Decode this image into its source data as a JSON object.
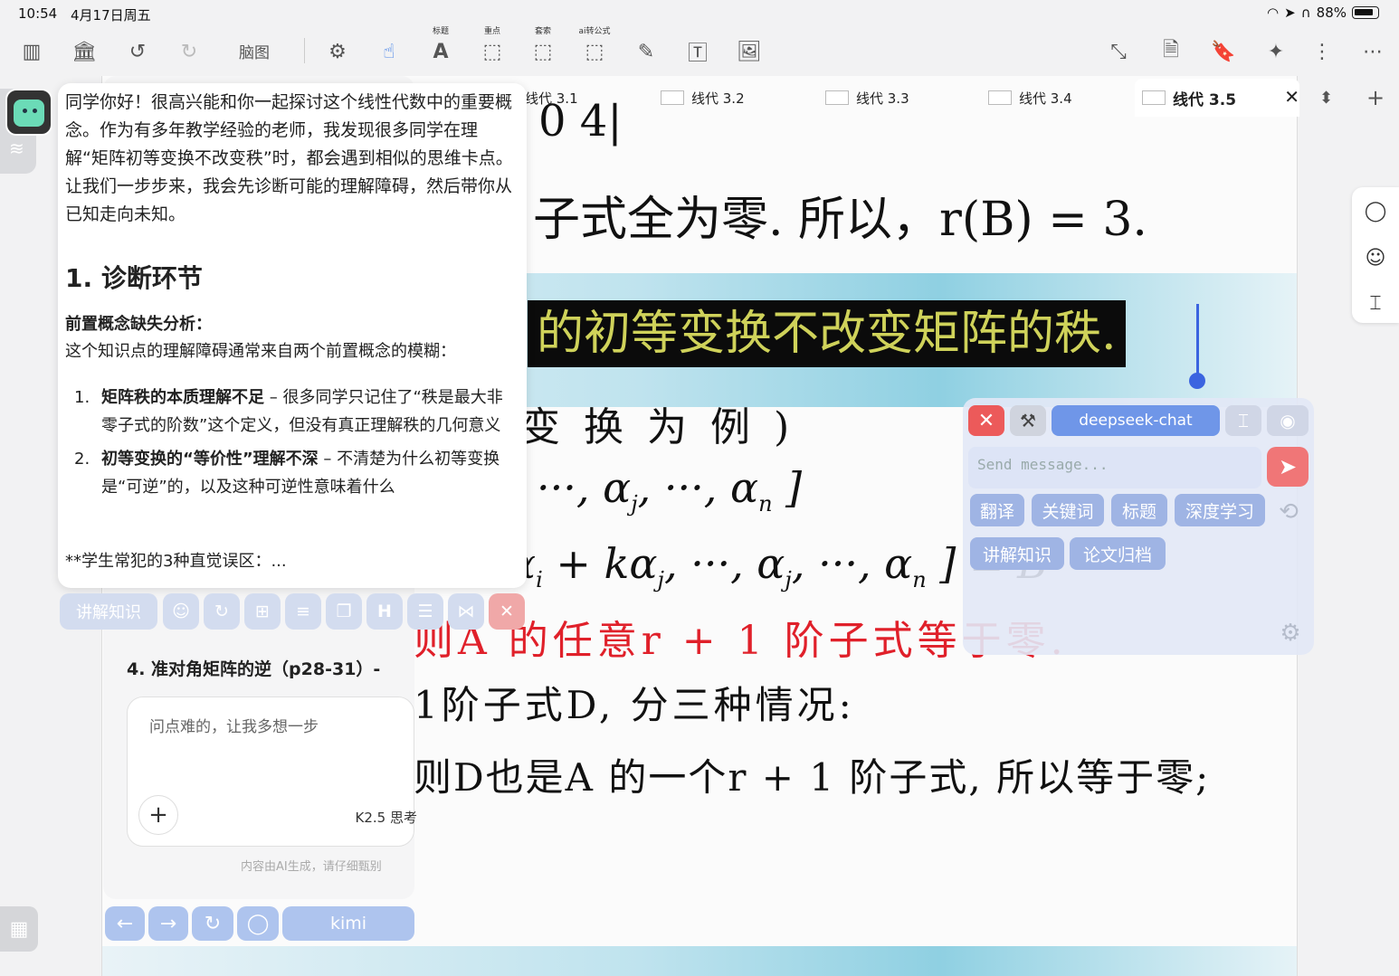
{
  "status": {
    "time": "10:54",
    "date": "4月17日周五",
    "battery": "88%"
  },
  "toolbar": {
    "mindmap_label": "脑图",
    "cap_title": "标题",
    "cap_highlight": "重点",
    "cap_lasso": "套索",
    "cap_ai_formula": "ai转公式"
  },
  "tabs": [
    {
      "label": "线代 3.1"
    },
    {
      "label": "线代 3.2"
    },
    {
      "label": "线代 3.3"
    },
    {
      "label": "线代 3.4"
    },
    {
      "label": "线代 3.5",
      "active": true
    }
  ],
  "doc": {
    "line_top": "0      4|",
    "line1": "子式全为零. 所以，r(B) = 3.",
    "headline": "的初等变换不改变矩阵的秩.",
    "line2": "变 换 为 例 )",
    "line3": "···, α",
    "line3_sub_j": "j",
    "line3_mid": ", ···, α",
    "line3_sub_n": "n",
    "line3_end": " ]",
    "line4": "α",
    "line4_rest": " + kα",
    "line4_tail": ", ···, α",
    "line4_end": ", ···, α",
    "line4_close": " ] = B",
    "red_line": "则A 的任意r + 1 阶子式等于零.",
    "line5": "1阶子式D, 分三种情况:",
    "line6": "则D也是A 的一个r + 1 阶子式, 所以等于零;"
  },
  "answer": {
    "intro": "同学你好！很高兴能和你一起探讨这个线性代数中的重要概念。作为有多年教学经验的老师，我发现很多同学在理解“矩阵初等变换不改变秩”时，都会遇到相似的思维卡点。让我们一步步来，我会先诊断可能的理解障碍，然后带你从已知走向未知。",
    "heading": "1. 诊断环节",
    "subheading": "前置概念缺失分析：",
    "sub_text": "这个知识点的理解障碍通常来自两个前置概念的模糊：",
    "items": [
      {
        "num": "1.",
        "bold": "矩阵秩的本质理解不足",
        "text": " – 很多同学只记住了“秩是最大非零子式的阶数”这个定义，但没有真正理解秩的几何意义"
      },
      {
        "num": "2.",
        "bold": "初等变换的“等价性”理解不深",
        "text": " – 不清楚为什么初等变换是“可逆”的，以及这种可逆性意味着什么"
      }
    ],
    "trail": "**学生常犯的3种直觉误区：..."
  },
  "actions": {
    "explain_label": "讲解知识"
  },
  "kimi": {
    "title": "4. 准对角矩阵的逆（p28-31）-",
    "input_placeholder": "问点难的，让我多想一步",
    "model": "K2.5 思考",
    "disclaimer": "内容由AI生成，请仔细甄别",
    "kimi_button": "kimi"
  },
  "deepseek": {
    "model": "deepseek-chat",
    "input_placeholder": "Send message...",
    "chips": [
      "翻译",
      "关键词",
      "标题",
      "深度学习",
      "讲解知识",
      "论文归档"
    ]
  }
}
